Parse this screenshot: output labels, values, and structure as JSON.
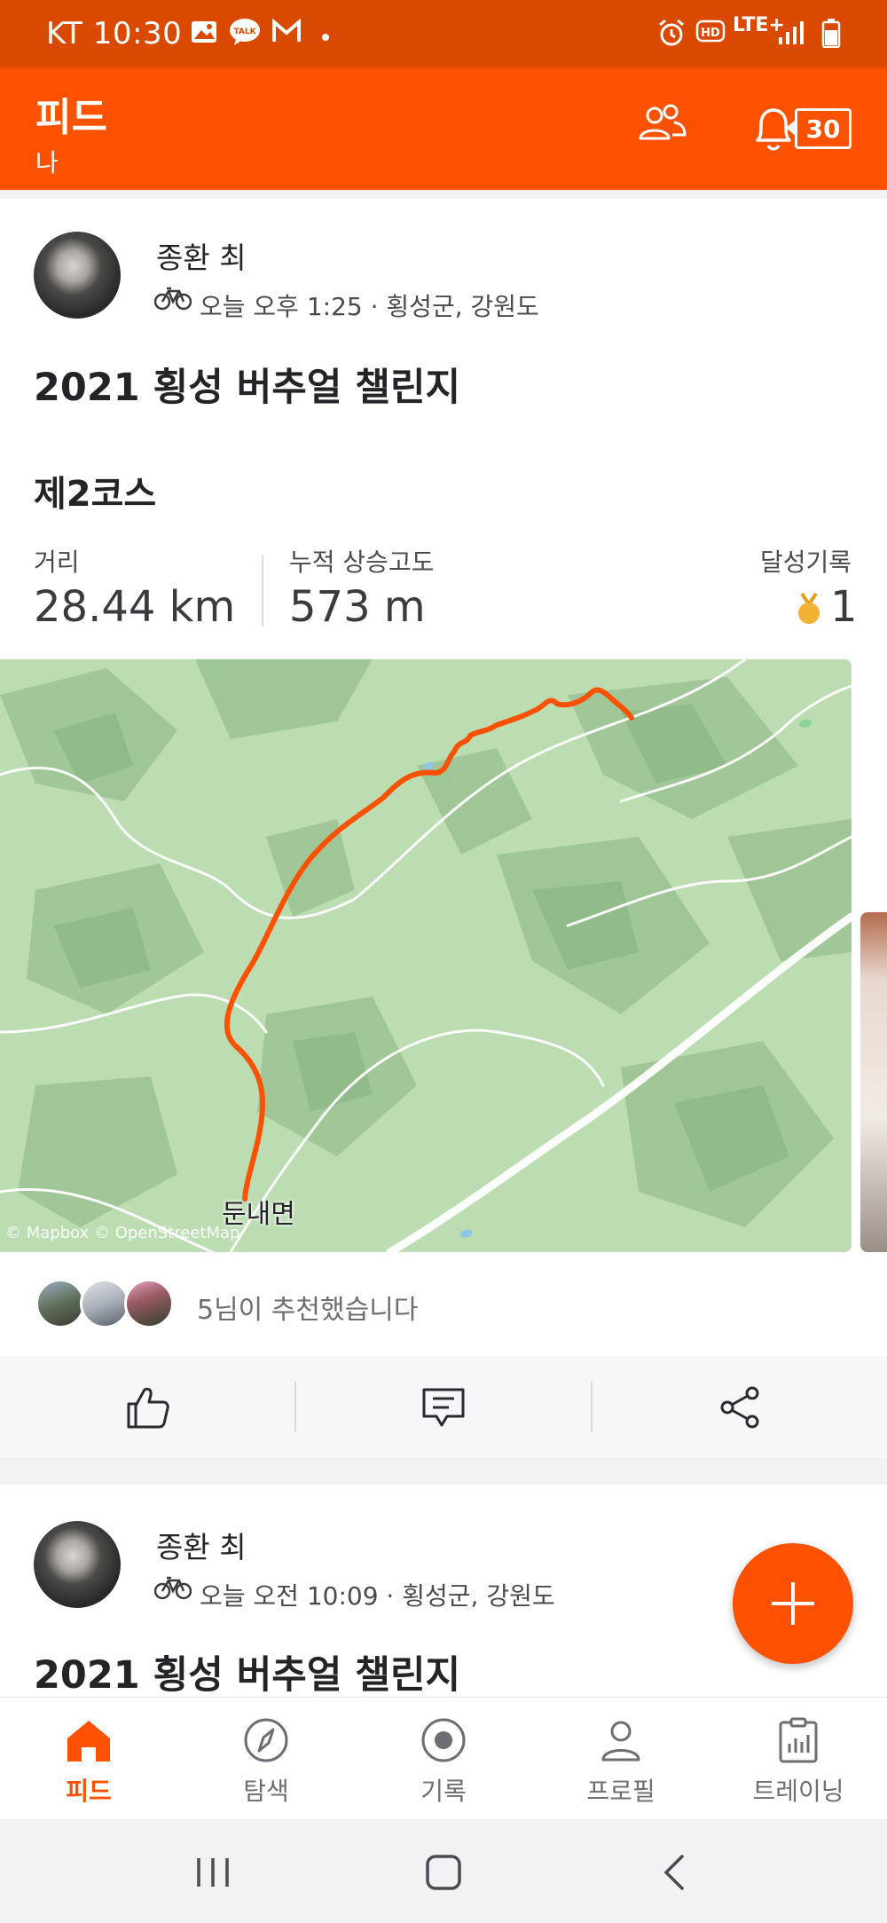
{
  "status_bar": {
    "carrier_time": "KT 10:30",
    "network": "LTE+"
  },
  "header": {
    "title": "피드",
    "subtitle": "나",
    "notification_count": "30"
  },
  "posts": [
    {
      "user": "종환 최",
      "meta": "오늘 오후 1:25 · 횡성군, 강원도",
      "title": "2021 횡성 버추얼 챌린지",
      "course": "제2코스",
      "stats": [
        {
          "label": "거리",
          "value": "28.44 km"
        },
        {
          "label": "누적 상승고도",
          "value": "573 m"
        },
        {
          "label": "달성기록",
          "value": "1"
        }
      ],
      "map": {
        "place_label": "둔내면",
        "attribution": "© Mapbox © OpenStreetMap"
      },
      "kudos_text": "5님이 추천했습니다"
    },
    {
      "user": "종환 최",
      "meta": "오늘 오전 10:09 · 횡성군, 강원도",
      "title": "2021 횡성 버추얼 챌린지"
    }
  ],
  "tabs": [
    {
      "label": "피드",
      "icon": "home-icon",
      "active": true
    },
    {
      "label": "탐색",
      "icon": "compass-icon",
      "active": false
    },
    {
      "label": "기록",
      "icon": "record-icon",
      "active": false
    },
    {
      "label": "프로필",
      "icon": "profile-icon",
      "active": false
    },
    {
      "label": "트레이닝",
      "icon": "training-icon",
      "active": false
    }
  ],
  "colors": {
    "brand": "#fc5200",
    "status_bar": "#d94a00",
    "route": "#fc5200",
    "map_bg": "#b9dcb0",
    "medal": "#f2b233"
  }
}
